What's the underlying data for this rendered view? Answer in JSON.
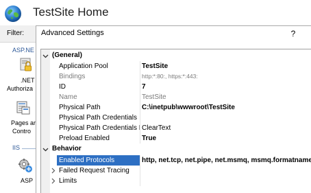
{
  "window": {
    "title": "TestSite Home",
    "icon": "globe-icon"
  },
  "left_pane": {
    "filter_label": "Filter:",
    "group_aspnet": "ASP.NE",
    "group_iis": "IIS",
    "features": [
      {
        "icon": "lock-icon",
        "label_line1": ".NET",
        "label_line2": "Authoriza"
      },
      {
        "icon": "pages-controls-icon",
        "label_line1": "Pages ar",
        "label_line2": "Contro"
      },
      {
        "icon": "gear-icon",
        "label_line1": "ASP",
        "label_line2": ""
      }
    ]
  },
  "dialog": {
    "title": "Advanced Settings",
    "help_label": "?",
    "categories": {
      "general": "(General)",
      "behavior": "Behavior"
    },
    "general_rows": [
      {
        "name": "Application Pool",
        "value": "TestSite",
        "style": "bold"
      },
      {
        "name": "Bindings",
        "value": "http:*:80:, https:*:443:",
        "style": "gray"
      },
      {
        "name": "ID",
        "value": "7",
        "style": "bold"
      },
      {
        "name": "Name",
        "value": "TestSite",
        "style": "gray"
      },
      {
        "name": "Physical Path",
        "value": "C:\\inetpub\\wwwroot\\TestSite",
        "style": "bold"
      },
      {
        "name": "Physical Path Credentials",
        "value": "",
        "style": "normal"
      },
      {
        "name": "Physical Path Credentials Lo",
        "value": "ClearText",
        "style": "normal"
      },
      {
        "name": "Preload Enabled",
        "value": "True",
        "style": "bold"
      }
    ],
    "behavior_rows": [
      {
        "name": "Enabled Protocols",
        "value": "http, net.tcp, net.pipe, net.msmq, msmq.formatname",
        "style": "bold",
        "selected": true
      },
      {
        "name": "Failed Request Tracing",
        "value": "",
        "style": "normal",
        "expandable": true
      },
      {
        "name": "Limits",
        "value": "",
        "style": "normal",
        "expandable": true
      }
    ]
  },
  "colors": {
    "selection": "#2d6fc3",
    "category_text": "#2b5797",
    "grid_margin": "#f0f0f0"
  }
}
